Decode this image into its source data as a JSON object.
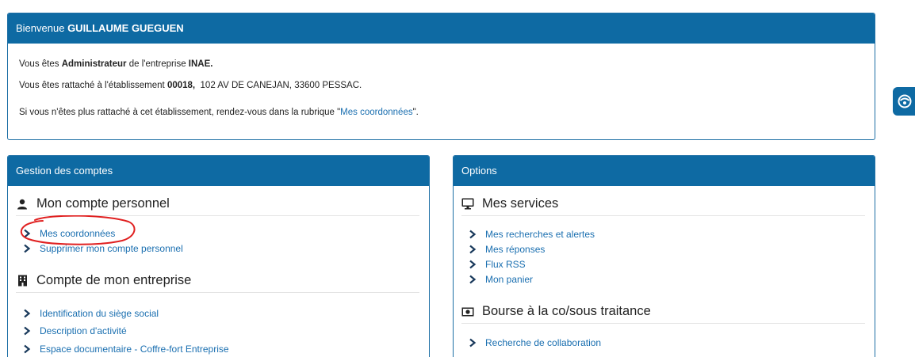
{
  "welcome": {
    "greeting": "Bienvenue ",
    "user_name": "GUILLAUME GUEGUEN",
    "line1": {
      "prefix": "Vous êtes ",
      "role": "Administrateur",
      "middle": " de l'entreprise ",
      "company": "INAE."
    },
    "line2": {
      "prefix": "Vous êtes rattaché à l'établissement ",
      "code": "00018,",
      "address": "  102 AV DE CANEJAN, 33600 PESSAC."
    },
    "line3": {
      "prefix": "Si vous n'êtes plus rattaché à cet établissement, rendez-vous dans la rubrique \"",
      "link": "Mes coordonnées",
      "suffix": "\"."
    }
  },
  "comptes": {
    "title": "Gestion des comptes",
    "personal": {
      "title": "Mon compte personnel",
      "icon": "user-icon",
      "items": [
        "Mes coordonnées",
        "Supprimer mon compte personnel"
      ]
    },
    "company": {
      "title": "Compte de mon entreprise",
      "icon": "building-icon",
      "items": [
        "Identification du siège social",
        "Description d'activité",
        "Espace documentaire - Coffre-fort Entreprise"
      ]
    }
  },
  "options": {
    "title": "Options",
    "services": {
      "title": "Mes services",
      "icon": "monitor-icon",
      "items": [
        "Mes recherches et alertes",
        "Mes réponses",
        "Flux RSS",
        "Mon panier"
      ]
    },
    "bourse": {
      "title": "Bourse à la co/sous traitance",
      "icon": "money-icon",
      "items": [
        "Recherche de collaboration"
      ]
    }
  },
  "floating_button": {
    "icon": "help-icon"
  },
  "colors": {
    "header": "#0e6aa3",
    "link": "#1a6fb0",
    "annotation": "#e02020"
  }
}
